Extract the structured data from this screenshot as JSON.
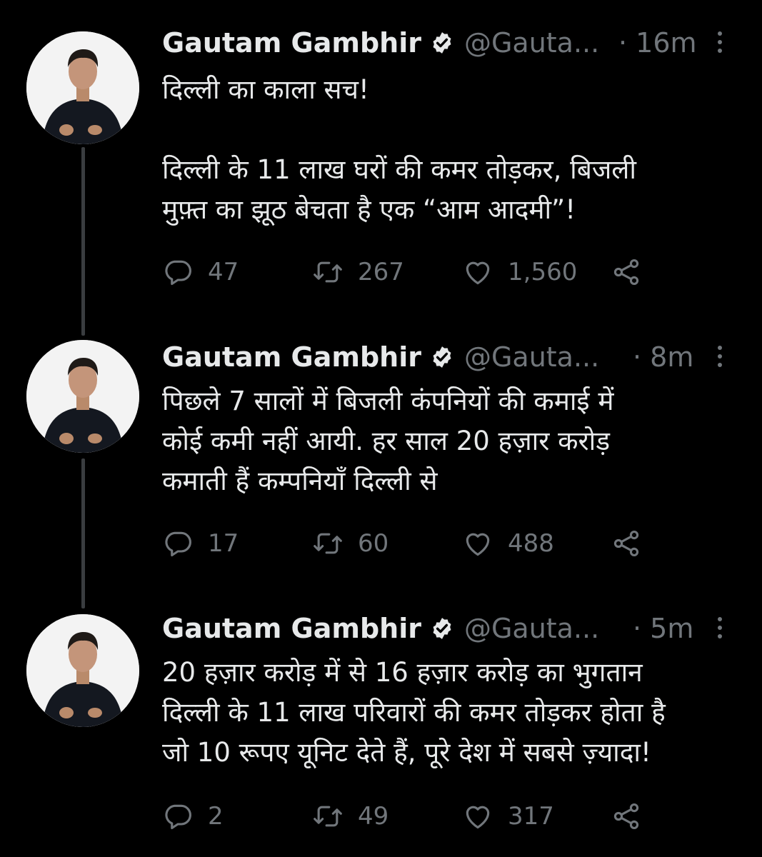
{
  "tweets": [
    {
      "author_name": "Gautam Gambhir",
      "handle": "@Gauta...",
      "time": "· 16m",
      "lines": [
        "दिल्ली का काला सच!",
        "",
        "दिल्ली के 11 लाख घरों की कमर तोड़कर, बिजली",
        "मुफ़्त का झूठ बेचता है एक “आम आदमी”!"
      ],
      "replies": "47",
      "retweets": "267",
      "likes": "1,560"
    },
    {
      "author_name": "Gautam Gambhir",
      "handle": "@Gauta...",
      "time": "· 8m",
      "lines": [
        "पिछले 7 सालों में बिजली कंपनियों की कमाई में",
        "कोई कमी नहीं आयी. हर साल 20 हज़ार करोड़",
        "कमाती हैं कम्पनियाँ दिल्ली से"
      ],
      "replies": "17",
      "retweets": "60",
      "likes": "488"
    },
    {
      "author_name": "Gautam Gambhir",
      "handle": "@Gauta...",
      "time": "· 5m",
      "lines": [
        "20 हज़ार करोड़ में से 16 हज़ार करोड़ का भुगतान",
        "दिल्ली के 11 लाख परिवारों की कमर तोड़कर होता है",
        "जो 10 रूपए यूनिट देते हैं, पूरे देश में सबसे ज़्यादा!"
      ],
      "replies": "2",
      "retweets": "49",
      "likes": "317"
    }
  ],
  "icons": {
    "reply": "reply-icon",
    "retweet": "retweet-icon",
    "like": "heart-icon",
    "share": "share-icon",
    "verified": "verified-badge-icon",
    "more": "more-options-icon"
  },
  "colors": {
    "background": "#000000",
    "primary_text": "#e7e9ea",
    "secondary_text": "#71767b",
    "thread_line": "#3a3d40"
  }
}
